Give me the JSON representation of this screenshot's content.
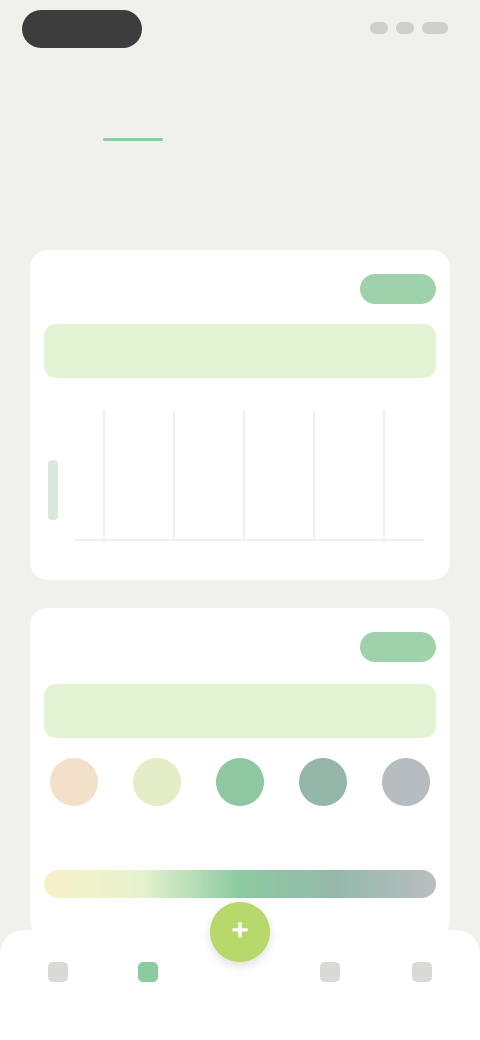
{
  "status_bar": {
    "time": "",
    "icons": [
      "signal-icon",
      "wifi-icon",
      "battery-icon"
    ]
  },
  "header": {
    "title": ""
  },
  "tabs": [
    {
      "label": "",
      "active": true
    },
    {
      "label": "",
      "active": false
    }
  ],
  "subtitle": "",
  "cards": [
    {
      "title": "",
      "chip": "",
      "banner": ""
    },
    {
      "title": "",
      "chip": "",
      "banner": ""
    }
  ],
  "moods": [
    {
      "label": "",
      "color": "#f3e0c9"
    },
    {
      "label": "",
      "color": "#e4edc8"
    },
    {
      "label": "",
      "color": "#8fc7a0"
    },
    {
      "label": "",
      "color": "#95b7aa"
    },
    {
      "label": "",
      "color": "#b7bcc0"
    }
  ],
  "bottom_nav": {
    "items": [
      {
        "icon": "home-icon",
        "active": false
      },
      {
        "icon": "stats-icon",
        "active": true
      },
      {
        "icon": "add-icon",
        "active": false
      },
      {
        "icon": "calendar-icon",
        "active": false
      },
      {
        "icon": "profile-icon",
        "active": false
      }
    ]
  },
  "colors": {
    "accent": "#8ccaa0",
    "background": "#f0f1ec",
    "fab": "#b7d96b"
  }
}
